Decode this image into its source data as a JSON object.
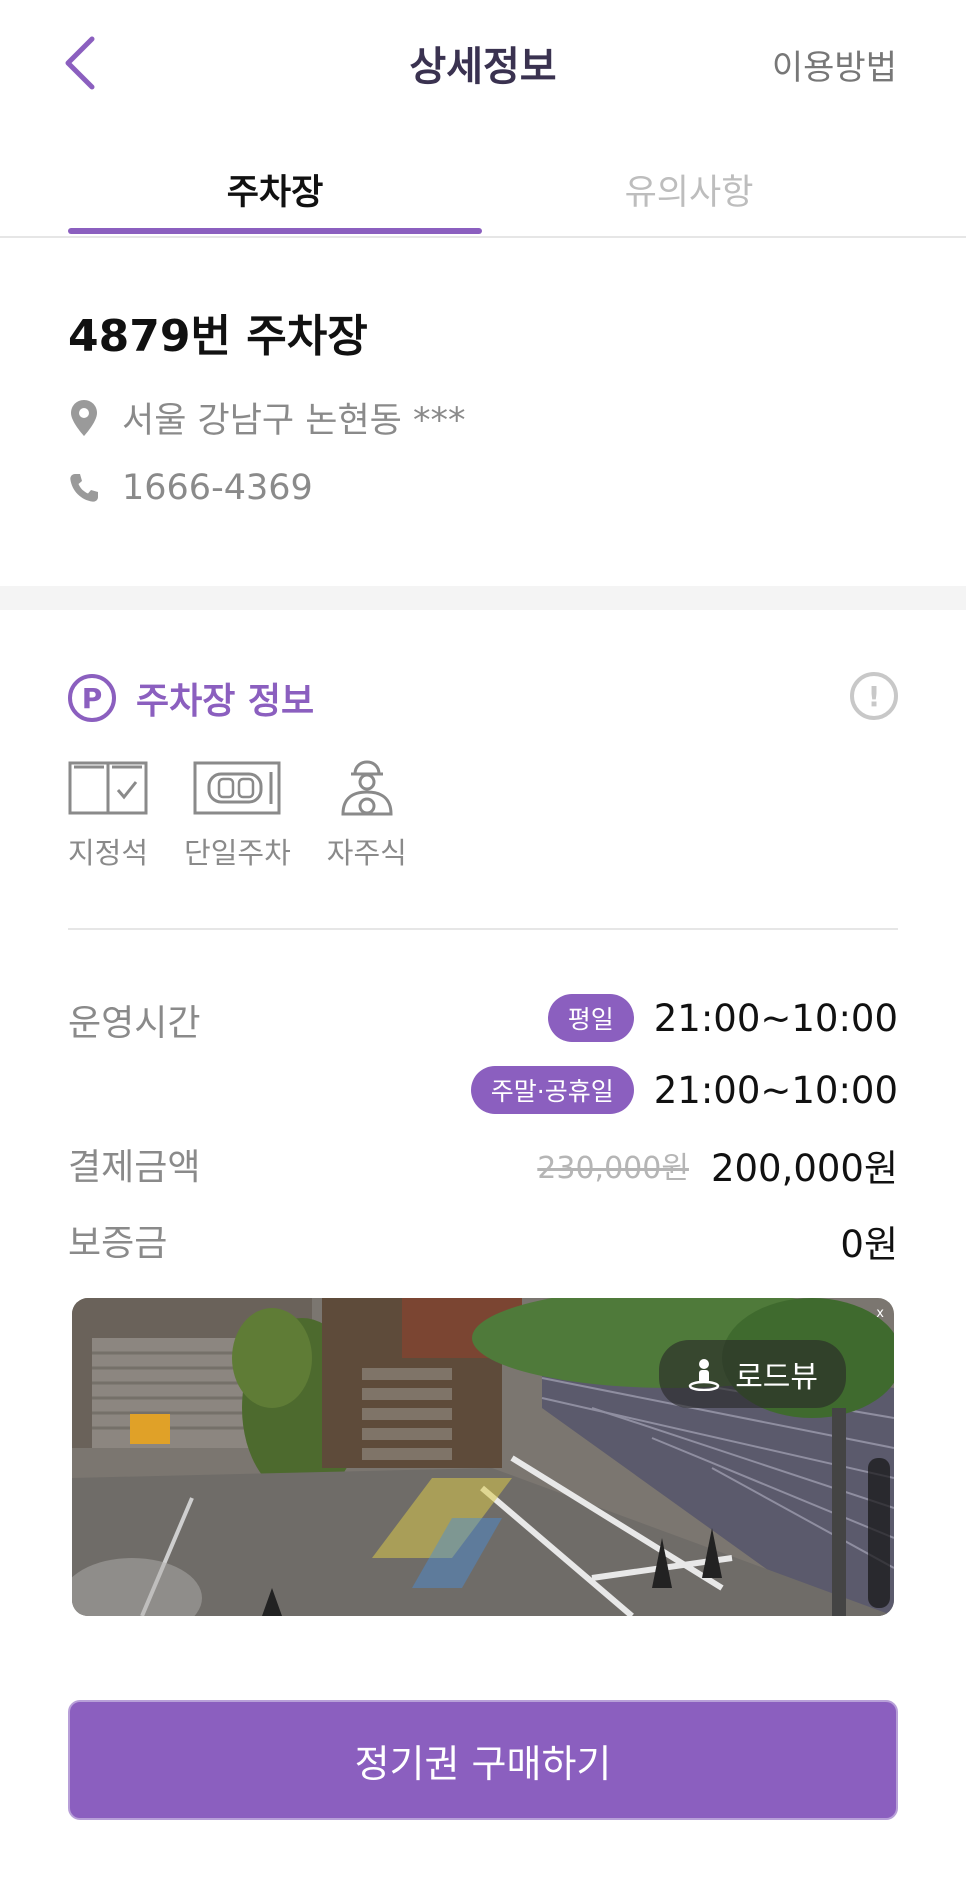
{
  "header": {
    "title": "상세정보",
    "help_label": "이용방법"
  },
  "tabs": [
    {
      "label": "주차장",
      "active": true
    },
    {
      "label": "유의사항",
      "active": false
    }
  ],
  "lot": {
    "name": "4879번 주차장",
    "address": "서울 강남구 논현동 ***",
    "phone": "1666-4369"
  },
  "section": {
    "title": "주차장 정보",
    "badge": "P",
    "notice_glyph": "!"
  },
  "features": [
    {
      "label": "지정석",
      "icon": "reserved-seat-icon"
    },
    {
      "label": "단일주차",
      "icon": "single-parking-icon"
    },
    {
      "label": "자주식",
      "icon": "self-parking-icon"
    }
  ],
  "hours": {
    "label": "운영시간",
    "weekday_tag": "평일",
    "weekday_time": "21:00~10:00",
    "weekend_tag": "주말·공휴일",
    "weekend_time": "21:00~10:00"
  },
  "payment": {
    "label": "결제금액",
    "original_price": "230,000원",
    "price": "200,000원"
  },
  "deposit": {
    "label": "보증금",
    "value": "0원"
  },
  "roadview": {
    "button_label": "로드뷰",
    "close_glyph": "x"
  },
  "cta": {
    "label": "정기권 구매하기"
  },
  "colors": {
    "accent": "#8b5fbf",
    "muted": "#8a8a8a"
  }
}
